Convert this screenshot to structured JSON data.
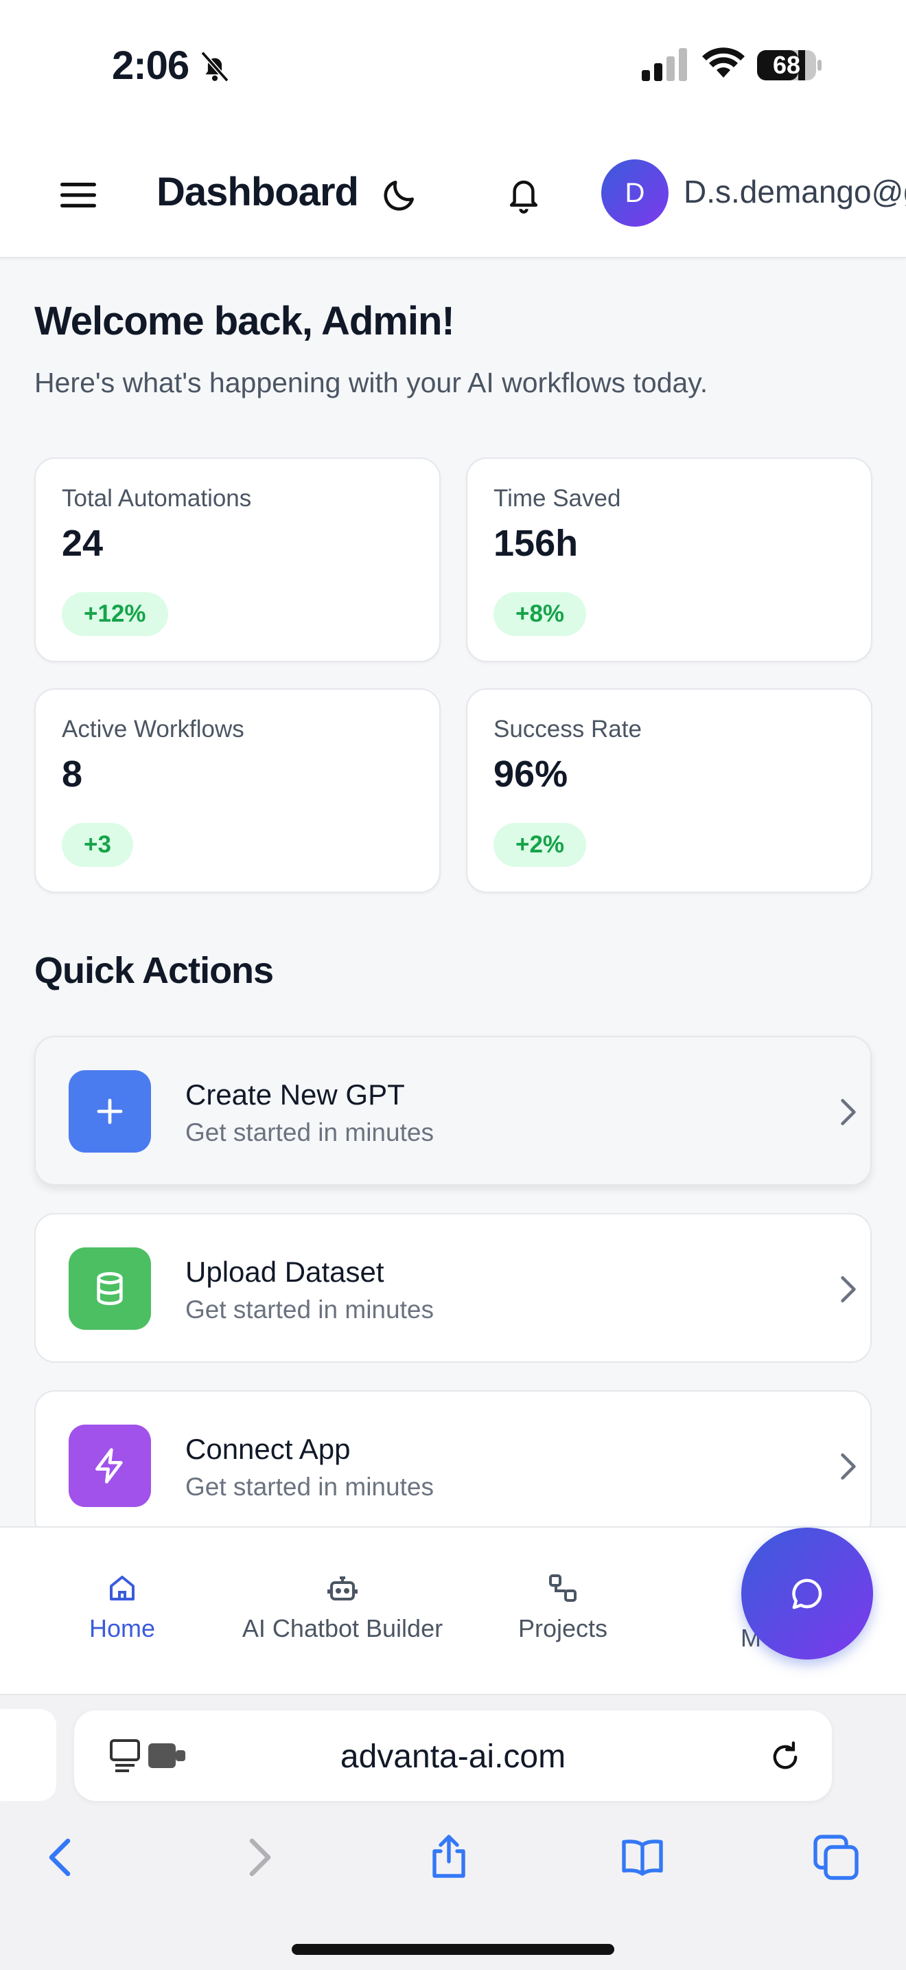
{
  "status_bar": {
    "time": "2:06",
    "battery": "68",
    "icons": [
      "bell-off-icon",
      "signal-icon",
      "wifi-icon",
      "battery-icon"
    ]
  },
  "header": {
    "title": "Dashboard",
    "avatar_initial": "D",
    "user_email": "D.s.demango@gr",
    "icons": [
      "menu-icon",
      "moon-icon",
      "bell-icon"
    ]
  },
  "welcome": {
    "title": "Welcome back, Admin!",
    "subtitle": "Here's what's happening with your AI workflows today."
  },
  "stats": [
    {
      "label": "Total Automations",
      "value": "24",
      "change": "+12%"
    },
    {
      "label": "Time Saved",
      "value": "156h",
      "change": "+8%"
    },
    {
      "label": "Active Workflows",
      "value": "8",
      "change": "+3"
    },
    {
      "label": "Success Rate",
      "value": "96%",
      "change": "+2%"
    }
  ],
  "quick_actions": {
    "title": "Quick Actions",
    "items": [
      {
        "name": "Create New GPT",
        "desc": "Get started in minutes",
        "icon": "plus-icon",
        "color": "#4a7cf0"
      },
      {
        "name": "Upload Dataset",
        "desc": "Get started in minutes",
        "icon": "database-icon",
        "color": "#4cbf63"
      },
      {
        "name": "Connect App",
        "desc": "Get started in minutes",
        "icon": "zap-icon",
        "color": "#a052ea"
      }
    ]
  },
  "bottom_nav": {
    "items": [
      {
        "label": "Home",
        "icon": "home-icon",
        "active": true
      },
      {
        "label": "AI Chatbot Builder",
        "icon": "bot-icon",
        "active": false
      },
      {
        "label": "Projects",
        "icon": "workflow-icon",
        "active": false
      },
      {
        "label": "M",
        "icon": "more-icon",
        "active": false
      }
    ],
    "fab_icon": "chat-bubble-icon"
  },
  "browser": {
    "url": "advanta-ai.com",
    "toolbar_icons": [
      "back-icon",
      "forward-icon",
      "share-icon",
      "bookmarks-icon",
      "tabs-icon"
    ]
  },
  "colors": {
    "accent": "#3b5bdb",
    "gradient_end": "#7c3aed",
    "badge_bg": "#dcfce7",
    "badge_text": "#16a34a"
  }
}
